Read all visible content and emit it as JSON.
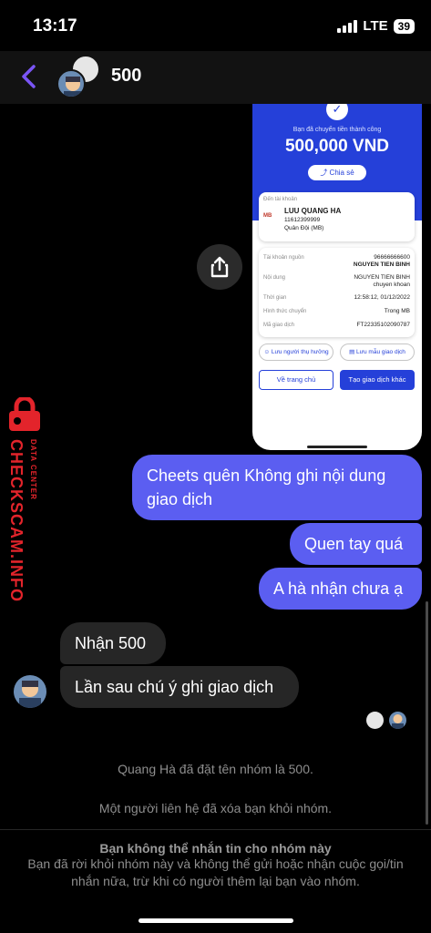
{
  "status_bar": {
    "time": "13:17",
    "network": "LTE",
    "battery": "39"
  },
  "header": {
    "title": "500",
    "back_icon": "chevron-left-icon"
  },
  "receipt": {
    "heading": "Bạn đã chuyển tiền thành công",
    "amount": "500,000 VND",
    "share_label": "Chia sẻ",
    "to_label": "Đến tài khoản",
    "bank_logo": "MB",
    "recipient_name": "LUU QUANG HA",
    "recipient_account": "11612399999",
    "recipient_bank": "Quân Đội (MB)",
    "rows": [
      {
        "label": "Tài khoản nguồn",
        "value": "96666666600",
        "value2": "NGUYEN TIEN BINH"
      },
      {
        "label": "Nội dung",
        "value": "NGUYEN TIEN BINH",
        "value2": "chuyen khoan"
      },
      {
        "label": "Thời gian",
        "value": "12:58:12, 01/12/2022"
      },
      {
        "label": "Hình thức chuyển",
        "value": "Trong MB"
      },
      {
        "label": "Mã giao dịch",
        "value": "FT22335102090787"
      }
    ],
    "save_beneficiary": "Lưu người thụ hưởng",
    "save_template": "Lưu mẫu giao dịch",
    "home_button": "Về trang chủ",
    "new_transaction_button": "Tạo giao dịch khác"
  },
  "watermark": {
    "brand": "CHECKSCAM.INFO",
    "sub": "DATA CENTER"
  },
  "messages": {
    "sent": [
      "Cheets quên Không ghi nội dung giao dịch",
      "Quen tay quá",
      "A hà nhận chưa ạ"
    ],
    "received": [
      "Nhận 500",
      "Lần sau chú ý ghi giao dịch"
    ]
  },
  "system": {
    "renamed": "Quang Hà đã đặt tên nhóm là 500.",
    "removed": "Một người liên hệ đã xóa bạn khỏi nhóm."
  },
  "footer": {
    "title": "Bạn không thể nhắn tin cho nhóm này",
    "body": "Bạn đã rời khỏi nhóm này và không thể gửi hoặc nhận cuộc gọi/tin nhắn nữa, trừ khi có người thêm lại bạn vào nhóm."
  },
  "colors": {
    "sent_bubble": "#5b5ef1",
    "received_bubble": "#262626",
    "accent": "#7a55f5",
    "bank_blue": "#2540d9",
    "watermark": "#e3242b"
  }
}
